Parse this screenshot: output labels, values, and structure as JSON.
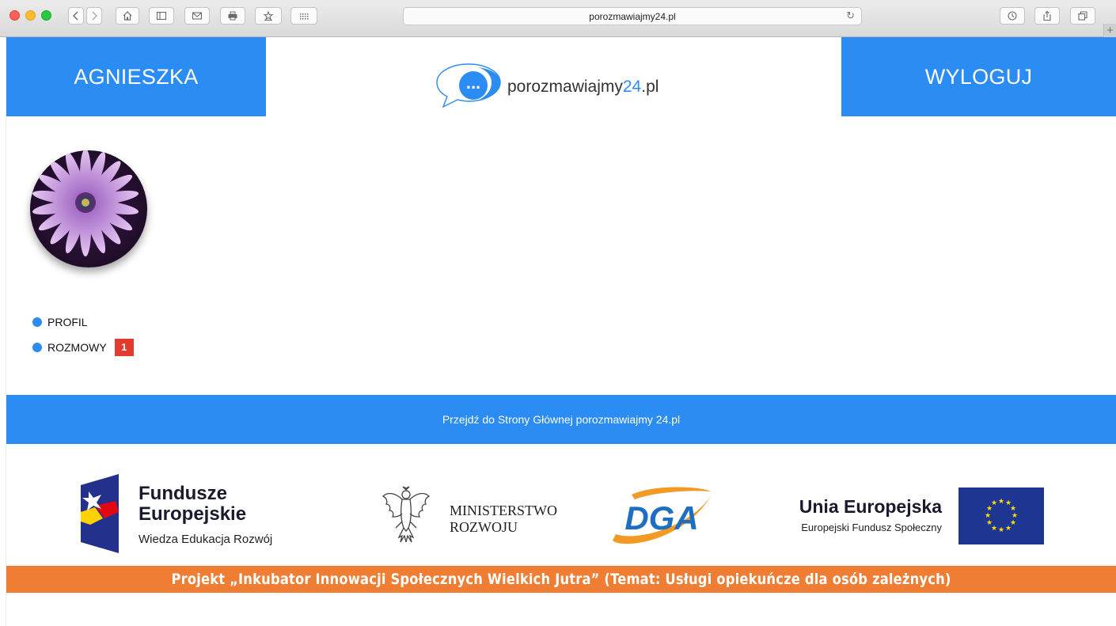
{
  "browser": {
    "url": "porozmawiajmy24.pl"
  },
  "header": {
    "user_name": "AGNIESZKA",
    "logout_label": "WYLOGUJ",
    "logo_text_main": "porozmawiajmy",
    "logo_text_accent": "24",
    "logo_text_suffix": ".pl",
    "logo_bubble_text": "..."
  },
  "sidebar": {
    "items": [
      {
        "label": "PROFIL"
      },
      {
        "label": "ROZMOWY",
        "badge": "1"
      }
    ]
  },
  "home_link": {
    "label": "Przejdź do Strony Głównej porozmawiajmy 24.pl"
  },
  "sponsors": {
    "fundusze_line1": "Fundusze",
    "fundusze_line2": "Europejskie",
    "fundusze_line3": "Wiedza Edukacja Rozwój",
    "ministry_line1": "MINISTERSTWO",
    "ministry_line2": "ROZWOJU",
    "dga_text": "DGA",
    "eu_line1": "Unia Europejska",
    "eu_line2": "Europejski Fundusz Społeczny"
  },
  "project_banner": {
    "text": "Projekt „Inkubator Innowacji Społecznych Wielkich Jutra” (Temat: Usługi opiekuńcze dla osób zależnych)"
  },
  "colors": {
    "primary_blue": "#2b8cf4",
    "badge_red": "#e53a2f",
    "banner_orange": "#f07d34"
  }
}
